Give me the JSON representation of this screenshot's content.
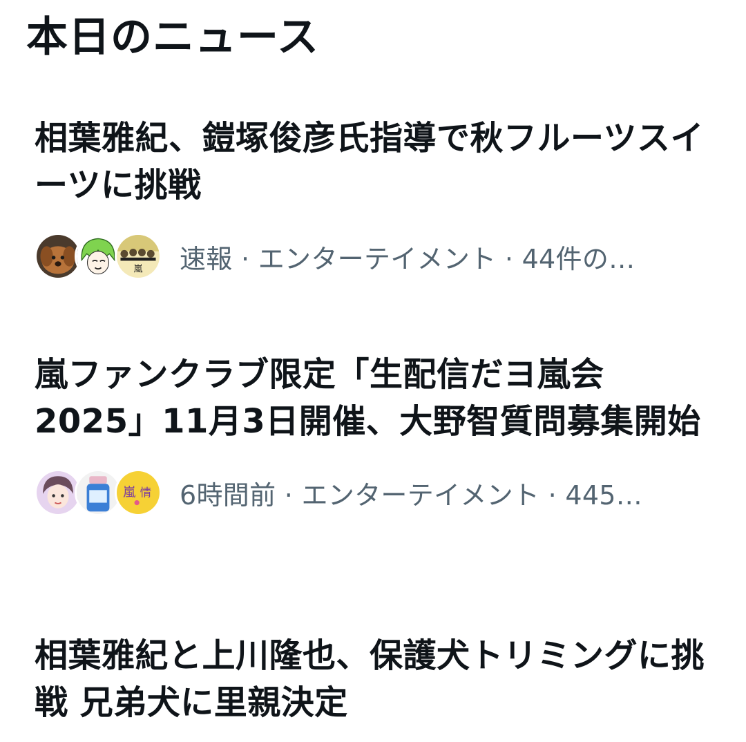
{
  "page": {
    "title": "本日のニュース"
  },
  "news": [
    {
      "headline": "相葉雅紀、鎧塚俊彦氏指導で秋フルーツスイーツに挑戦",
      "meta": "速報 · エンターテイメント · 44件の…",
      "avatars": [
        "dog-photo-avatar",
        "green-hair-illustration-avatar",
        "arashi-group-illustration-avatar"
      ]
    },
    {
      "headline": "嵐ファンクラブ限定「生配信だヨ嵐会2025」11月3日開催、大野智質問募集開始",
      "meta": "6時間前 · エンターテイメント · 445…",
      "avatars": [
        "person-illustration-avatar",
        "blue-bottle-avatar",
        "arashi-info-avatar"
      ]
    },
    {
      "headline": "相葉雅紀と上川隆也、保護犬トリミングに挑戦 兄弟犬に里親決定"
    }
  ],
  "colors": {
    "text": "#0f1419",
    "meta": "#536471",
    "background": "#ffffff"
  }
}
